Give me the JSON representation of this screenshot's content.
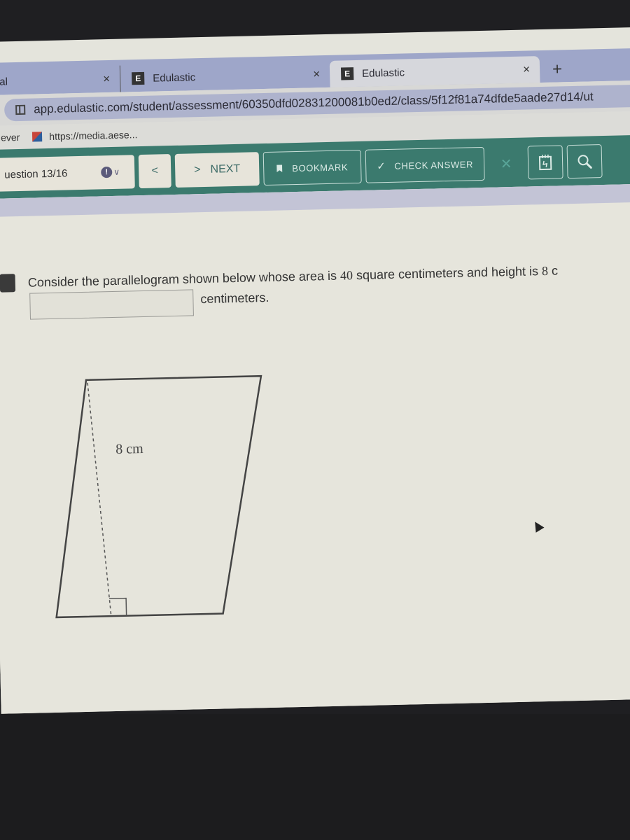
{
  "browser": {
    "tabs": [
      {
        "label": "al",
        "close_icon": "×"
      },
      {
        "label": "Edulastic",
        "favicon": "E",
        "close_icon": "×"
      },
      {
        "label": "Edulastic",
        "favicon": "E",
        "close_icon": "×",
        "active": true
      }
    ],
    "new_tab_icon": "+",
    "address": "app.edulastic.com/student/assessment/60350dfd02831200081b0ed2/class/5f12f81a74dfde5aade27d14/ut",
    "bookmarks": [
      {
        "label": "ever"
      },
      {
        "label": "https://media.aese..."
      }
    ]
  },
  "assessment_toolbar": {
    "question_selector": "uestion 13/16",
    "alert_icon": "!",
    "chevron_icon": "∨",
    "prev_icon": "<",
    "next_icon": ">",
    "next_label": "NEXT",
    "bookmark_label": "BOOKMARK",
    "check_icon": "✓",
    "check_answer_label": "CHECK ANSWER",
    "clear_icon": "×",
    "colors": {
      "bar": "#3b7a6e",
      "button_bg": "#e7e4da",
      "outline_text": "#dcebe6"
    }
  },
  "question": {
    "text_before": "Consider the parallelogram shown below whose area is ",
    "area_value": "40",
    "text_middle": " square centimeters and height is ",
    "height_value": "8",
    "text_after": " c",
    "answer_value": "",
    "unit_label": "centimeters."
  },
  "figure": {
    "shape": "parallelogram",
    "height_label": "8 cm",
    "has_right_angle_marker": true,
    "has_dashed_height": true
  }
}
